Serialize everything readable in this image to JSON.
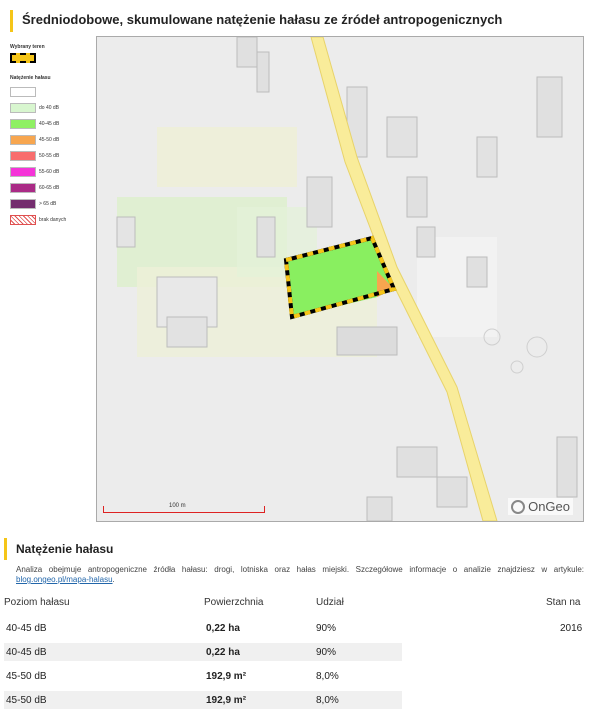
{
  "report": {
    "title": "Średniodobowe, skumulowane natężenie hałasu ze źródeł antropogenicznych"
  },
  "legend": {
    "selected_area_label": "Wybrany teren",
    "noise_label": "Natężenie hałasu",
    "items": [
      {
        "label": "",
        "color": "#ffffff"
      },
      {
        "label": "do 40 dB",
        "color": "#d8f6cf"
      },
      {
        "label": "40-45 dB",
        "color": "#8ff063"
      },
      {
        "label": "45-50 dB",
        "color": "#f7a64f"
      },
      {
        "label": "50-55 dB",
        "color": "#f86d6d"
      },
      {
        "label": "55-60 dB",
        "color": "#f534d8"
      },
      {
        "label": "60-65 dB",
        "color": "#aa2b86"
      },
      {
        "label": "> 65 dB",
        "color": "#742d6e"
      },
      {
        "label": "brak danych",
        "color": "hatch"
      }
    ]
  },
  "map": {
    "scale_label": "100 m",
    "logo_text": "OnGeo",
    "selected_area_color": "#f5c518"
  },
  "section": {
    "title": "Natężenie hałasu",
    "description": "Analiza obejmuje antropogeniczne źródła hałasu: drogi, lotniska oraz hałas miejski. Szczegółowe informacje o analizie znajdziesz w artykule:",
    "link_text": "blog.ongeo.pl/mapa-halasu",
    "link_suffix": "."
  },
  "table": {
    "headers": {
      "level": "Poziom hałasu",
      "area": "Powierzchnia",
      "share": "Udział",
      "as_of": "Stan na"
    },
    "rows": [
      {
        "level": "40-45 dB",
        "area": "0,22 ha",
        "share": "90%",
        "as_of": "2016"
      },
      {
        "level": "40-45 dB",
        "area": "0,22 ha",
        "share": "90%",
        "as_of": ""
      },
      {
        "level": "45-50 dB",
        "area": "192,9 m²",
        "share": "8,0%",
        "as_of": ""
      },
      {
        "level": "45-50 dB",
        "area": "192,9 m²",
        "share": "8,0%",
        "as_of": ""
      }
    ]
  }
}
